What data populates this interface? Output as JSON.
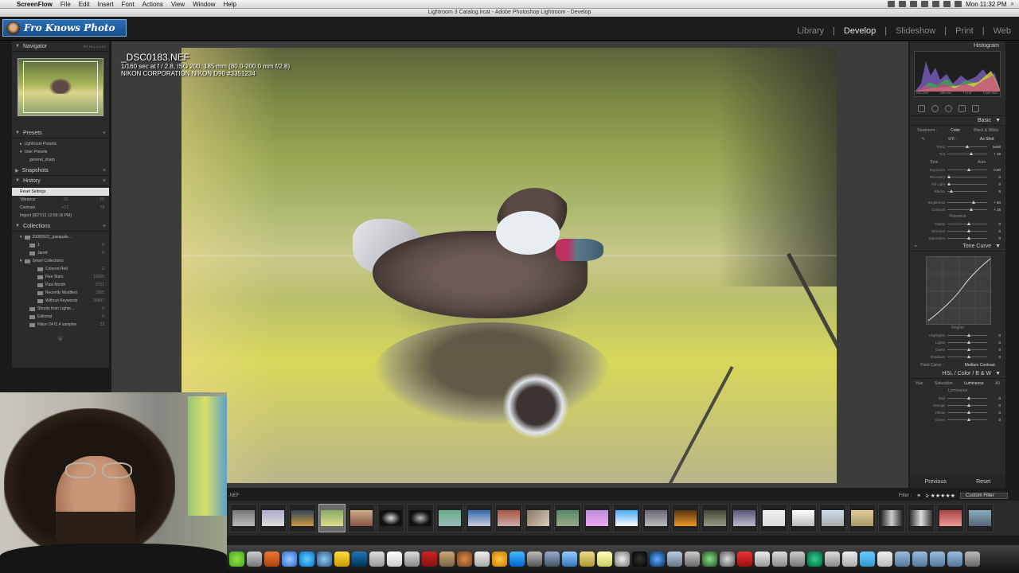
{
  "menubar": {
    "app": "ScreenFlow",
    "items": [
      "File",
      "Edit",
      "Insert",
      "Font",
      "Actions",
      "View",
      "Window",
      "Help"
    ],
    "clock": "Mon 11:32 PM"
  },
  "window": {
    "title": "Lightroom 3 Catalog.lrcat - Adobe Photoshop Lightroom - Develop"
  },
  "logo": {
    "text": "Fro Knows Photo"
  },
  "modules": [
    "Library",
    "Develop",
    "Slideshow",
    "Print",
    "Web"
  ],
  "active_module": "Develop",
  "left_panel": {
    "navigator": {
      "label": "Navigator",
      "zoom": "FIT  FILL  1:1  3:1"
    },
    "presets": {
      "label": "Presets",
      "items": [
        "Lightroom Presets",
        "User Presets",
        "general_sharp"
      ]
    },
    "snapshots": {
      "label": "Snapshots"
    },
    "history": {
      "label": "History",
      "items": [
        {
          "name": "Reset Settings",
          "a": "",
          "b": ""
        },
        {
          "name": "Vibrance",
          "a": "-15",
          "b": "15"
        },
        {
          "name": "Contrast",
          "a": "+13",
          "b": "73"
        },
        {
          "name": "Import (8/27/11 12:59:16 PM)",
          "a": "",
          "b": ""
        }
      ]
    },
    "collections": {
      "label": "Collections",
      "items": [
        {
          "name": "20080622_pasquale...",
          "count": ""
        },
        {
          "name": "1",
          "count": "0"
        },
        {
          "name": "Jared",
          "count": "0"
        },
        {
          "name": "Smart Collections",
          "count": ""
        },
        {
          "name": "Colored Red",
          "count": "2"
        },
        {
          "name": "Five Stars",
          "count": "19265"
        },
        {
          "name": "Past Month",
          "count": "3751"
        },
        {
          "name": "Recently Modified",
          "count": "1955"
        },
        {
          "name": "Without Keywords",
          "count": "38887"
        },
        {
          "name": "Shoots from Lighte...",
          "count": "0"
        },
        {
          "name": "Editorial",
          "count": "0"
        },
        {
          "name": "Nikon 24 f1.4 samples",
          "count": "22"
        }
      ]
    }
  },
  "photo_info": {
    "filename": "_DSC0183.NEF",
    "exposure": "1/160 sec at f / 2.8, ISO 200, 185 mm (80.0-200.0 mm f/2.8)",
    "camera": "NIKON CORPORATION NIKON D90 #3351234"
  },
  "right_panel": {
    "histogram": {
      "label": "Histogram",
      "info": [
        "ISO 200",
        "185 mm",
        "f / 2.8",
        "1/160 SEC"
      ]
    },
    "basic": {
      "label": "Basic",
      "treatment_label": "Treatment :",
      "treatments": [
        "Color",
        "Black & White"
      ],
      "wb_label": "WB :",
      "wb_value": "As Shot",
      "temp": {
        "label": "Temp",
        "value": "5400"
      },
      "tint": {
        "label": "Tint",
        "value": "+ 19"
      },
      "tone_label": "Tone",
      "auto": "Auto",
      "tone": [
        {
          "label": "Exposure",
          "value": "0.00"
        },
        {
          "label": "Recovery",
          "value": "0"
        },
        {
          "label": "Fill Light",
          "value": "0"
        },
        {
          "label": "Blacks",
          "value": "5"
        }
      ],
      "tone2": [
        {
          "label": "Brightness",
          "value": "+ 50"
        },
        {
          "label": "Contrast",
          "value": "+ 25"
        }
      ],
      "presence_label": "Presence",
      "presence": [
        {
          "label": "Clarity",
          "value": "0"
        },
        {
          "label": "Vibrance",
          "value": "0"
        },
        {
          "label": "Saturation",
          "value": "0"
        }
      ]
    },
    "tone_curve": {
      "label": "Tone Curve",
      "region_label": "Region",
      "regions": [
        {
          "label": "Highlights",
          "value": "0"
        },
        {
          "label": "Lights",
          "value": "0"
        },
        {
          "label": "Darks",
          "value": "0"
        },
        {
          "label": "Shadows",
          "value": "0"
        }
      ],
      "point_curve_label": "Point Curve :",
      "point_curve_value": "Medium Contrast"
    },
    "hsl": {
      "label": "HSL  /  Color  /  B & W",
      "tabs": [
        "Hue",
        "Saturation",
        "Luminance",
        "All"
      ],
      "sub_label": "Luminance",
      "items": [
        {
          "label": "Red",
          "value": "0"
        },
        {
          "label": "Orange",
          "value": "0"
        },
        {
          "label": "Yellow",
          "value": "0"
        },
        {
          "label": "Green",
          "value": "0"
        }
      ]
    },
    "previous": "Previous",
    "reset": "Reset"
  },
  "filmstrip": {
    "source": ".NEF",
    "filter_label": "Filter :",
    "custom_filter": "Custom Filter",
    "stars": "≥ ★★★★★"
  }
}
